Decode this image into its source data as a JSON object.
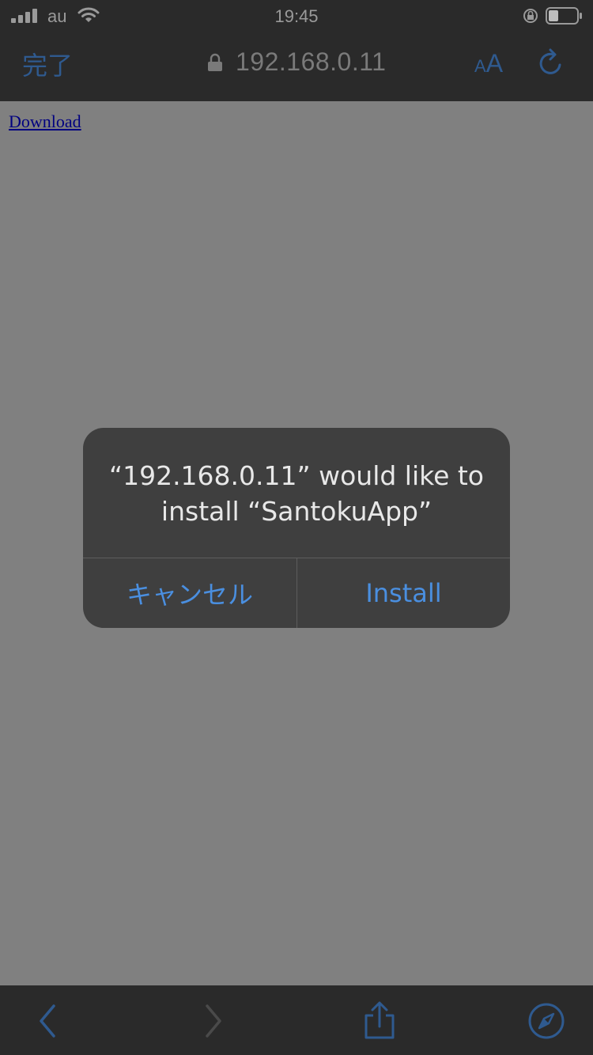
{
  "status_bar": {
    "carrier": "au",
    "time": "19:45"
  },
  "nav_bar": {
    "done_label": "完了",
    "url": "192.168.0.11",
    "text_size_small": "A",
    "text_size_big": "A"
  },
  "page": {
    "link_text": "Download"
  },
  "alert": {
    "title_line1": "“192.168.0.11” would like to",
    "title_line2": "install “SantokuApp”",
    "cancel_label": "キャンセル",
    "install_label": "Install"
  },
  "colors": {
    "accent": "#4a8fe0",
    "dim_accent": "#2f5a8f",
    "overlay": "#808080",
    "alert_bg": "#3f3f3f"
  },
  "icons": {
    "signal": "signal-icon",
    "wifi": "wifi-icon",
    "rotation_lock": "rotation-lock-icon",
    "battery": "battery-icon",
    "padlock": "padlock-icon",
    "reload": "reload-icon",
    "back": "back-icon",
    "forward": "forward-icon",
    "share": "share-icon",
    "safari": "compass-icon"
  }
}
